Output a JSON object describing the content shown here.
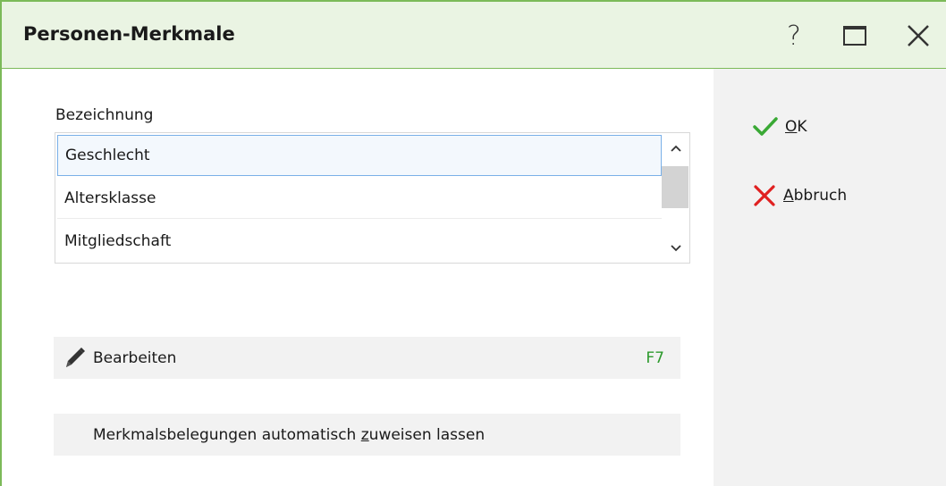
{
  "window": {
    "title": "Personen-Merkmale",
    "help_label": "?"
  },
  "list": {
    "label": "Bezeichnung",
    "items": [
      {
        "label": "Geschlecht",
        "selected": true
      },
      {
        "label": "Altersklasse",
        "selected": false
      },
      {
        "label": "Mitgliedschaft",
        "selected": false
      }
    ]
  },
  "commands": {
    "edit": {
      "label": "Bearbeiten",
      "shortcut": "F7"
    },
    "assign": {
      "pre": "Merkmalsbelegungen automatisch ",
      "underlined": "z",
      "post": "uweisen lassen"
    }
  },
  "actions": {
    "ok": {
      "underlined": "O",
      "rest": "K"
    },
    "cancel": {
      "underlined": "A",
      "rest": "bbruch"
    }
  },
  "colors": {
    "accent_green": "#7cba59",
    "titlebar_bg": "#eaf4e3",
    "ok_check": "#3aa935",
    "cancel_x": "#e02020",
    "shortcut": "#2e9a2e",
    "selection_border": "#7ab0e8"
  },
  "icons": [
    "help-icon",
    "maximize-icon",
    "close-icon",
    "check-icon",
    "cross-icon",
    "pencil-icon",
    "chevron-up-icon",
    "chevron-down-icon"
  ]
}
